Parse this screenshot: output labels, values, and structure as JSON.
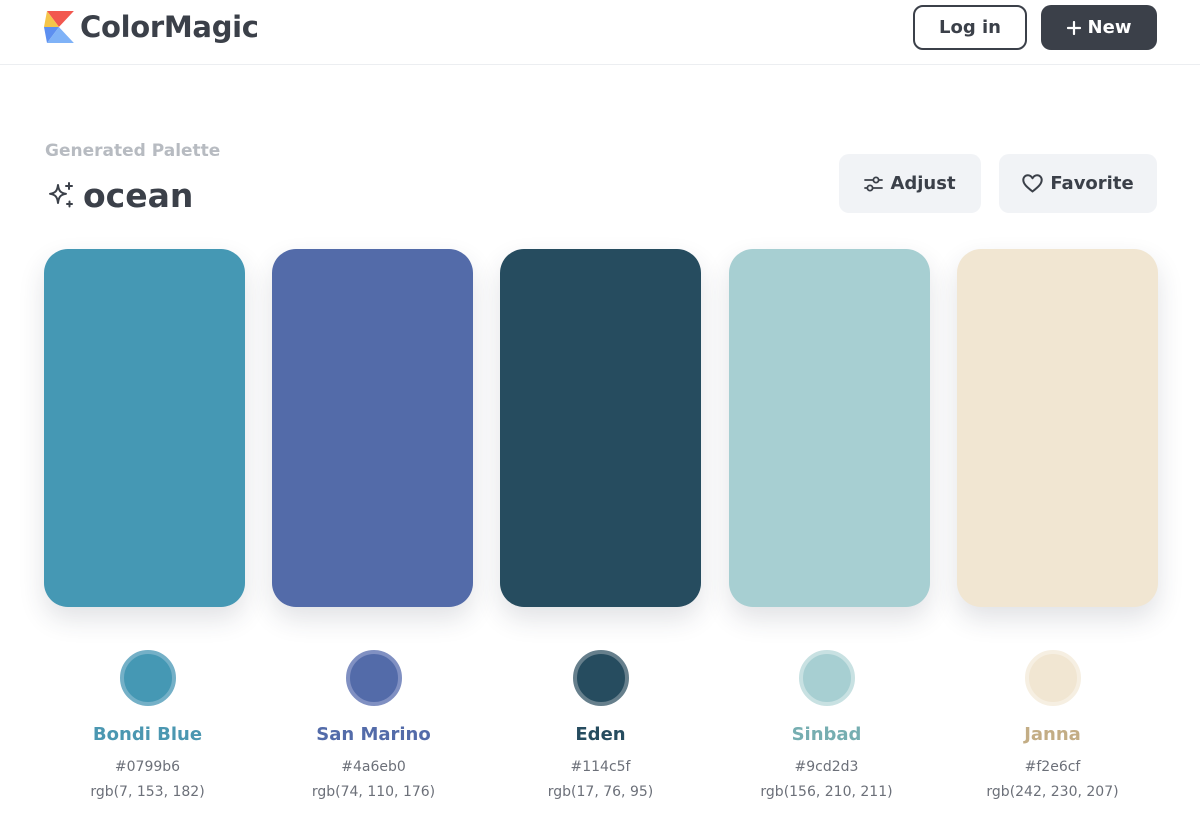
{
  "app": {
    "name": "ColorMagic",
    "logo_icon": "colormagic-logo-icon"
  },
  "header": {
    "login_label": "Log in",
    "new_label": "New",
    "new_icon": "plus-icon"
  },
  "palette": {
    "subtitle": "Generated Palette",
    "title": "ocean",
    "title_icon": "sparkles-icon",
    "adjust_label": "Adjust",
    "adjust_icon": "sliders-icon",
    "favorite_label": "Favorite",
    "favorite_icon": "heart-icon",
    "colors": [
      {
        "name": "Bondi Blue",
        "hex": "#0799b6",
        "rgb": "rgb(7, 153, 182)",
        "display": "#4598b4",
        "ring": "#74b0c7",
        "text": "#4b97b1"
      },
      {
        "name": "San Marino",
        "hex": "#4a6eb0",
        "rgb": "rgb(74, 110, 176)",
        "display": "#536ba9",
        "ring": "#8090c2",
        "text": "#536ba9"
      },
      {
        "name": "Eden",
        "hex": "#114c5f",
        "rgb": "rgb(17, 76, 95)",
        "display": "#264c5f",
        "ring": "#667f8c",
        "text": "#264c5f"
      },
      {
        "name": "Sinbad",
        "hex": "#9cd2d3",
        "rgb": "rgb(156, 210, 211)",
        "display": "#a7cfd2",
        "ring": "#c8e1e2",
        "text": "#76aeb1"
      },
      {
        "name": "Janna",
        "hex": "#f2e6cf",
        "rgb": "rgb(242, 230, 207)",
        "display": "#f1e6d2",
        "ring": "#f6efe2",
        "text": "#c3ad85"
      }
    ]
  }
}
